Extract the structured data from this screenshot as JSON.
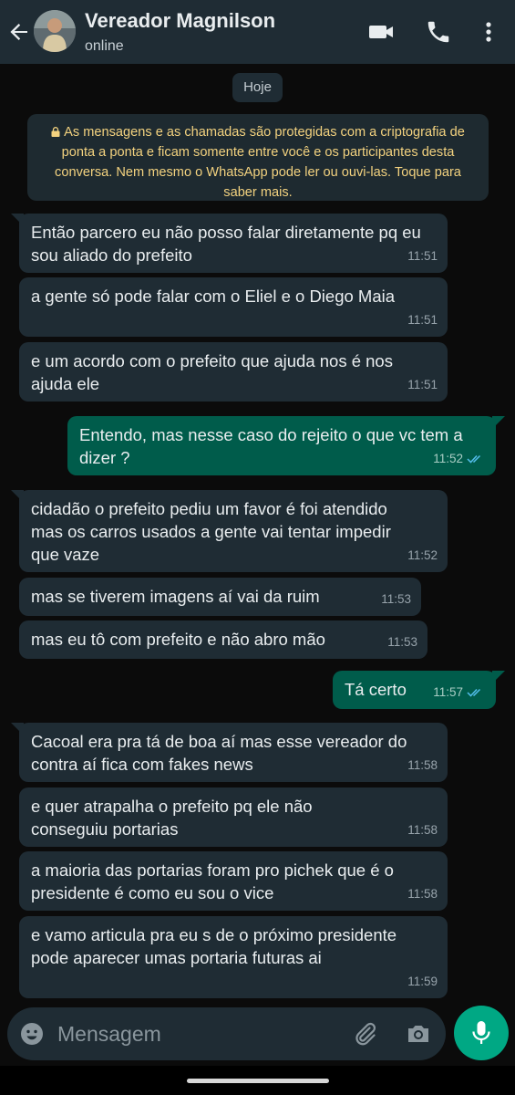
{
  "header": {
    "contact_name": "Vereador Magnilson",
    "status": "online",
    "icons": [
      "back-arrow-icon",
      "avatar",
      "video-call-icon",
      "phone-call-icon",
      "more-vert-icon"
    ]
  },
  "chat": {
    "date_chip": "Hoje",
    "encryption_notice": "As mensagens e as chamadas são protegidas com a criptografia de ponta a ponta e ficam somente entre você e os participantes desta conversa. Nem mesmo o WhatsApp pode ler ou ouvi-las. Toque para saber mais.",
    "messages": [
      {
        "dir": "in",
        "text": "Então parcero  eu não posso falar diretamente pq eu sou aliado do prefeito",
        "time": "11:51"
      },
      {
        "dir": "in",
        "text": "a gente só pode falar com o Eliel e o Diego Maia",
        "time": "11:51"
      },
      {
        "dir": "in",
        "text": "e um acordo com o prefeito que ajuda nos é nos ajuda ele",
        "time": "11:51"
      },
      {
        "dir": "out",
        "text": "Entendo, mas nesse caso do rejeito o que vc tem a dizer ?",
        "time": "11:52"
      },
      {
        "dir": "in",
        "text": "cidadão o prefeito pediu um favor é foi atendido mas os carros usados a gente vai tentar impedir que vaze",
        "time": "11:52"
      },
      {
        "dir": "in",
        "text": "mas se tiverem imagens aí vai da ruim",
        "time": "11:53"
      },
      {
        "dir": "in",
        "text": "mas eu tô com prefeito e não abro mão",
        "time": "11:53"
      },
      {
        "dir": "out",
        "text": "Tá certo",
        "time": "11:57"
      },
      {
        "dir": "in",
        "text": "Cacoal era pra tá de boa aí mas esse vereador do contra aí fica com fakes news",
        "time": "11:58"
      },
      {
        "dir": "in",
        "text": "e quer atrapalha o prefeito pq ele não conseguiu portarias",
        "time": "11:58"
      },
      {
        "dir": "in",
        "text": "a maioria das portarias foram pro pichek  que é o presidente é como eu sou o vice",
        "time": "11:58"
      },
      {
        "dir": "in",
        "text": "e vamo articula pra eu s de o próximo presidente pode aparecer umas portaria futuras ai",
        "time": "11:59"
      }
    ]
  },
  "composer": {
    "placeholder": "Mensagem",
    "icons": [
      "emoji-icon",
      "attach-icon",
      "camera-icon",
      "mic-icon"
    ]
  },
  "colors": {
    "header_bg": "#1f2c34",
    "incoming_bubble": "#1f2c34",
    "outgoing_bubble": "#005c4b",
    "accent": "#00a884",
    "notice_text": "#f3d27f",
    "read_ticks": "#53bdeb"
  }
}
